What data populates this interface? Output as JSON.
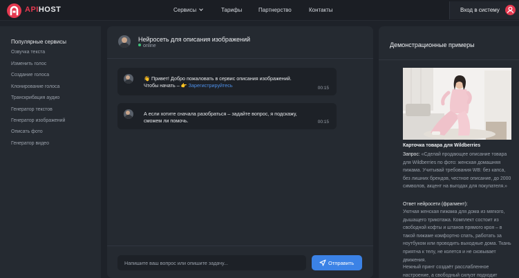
{
  "brand": {
    "part1": "API",
    "part2": "HOST"
  },
  "nav": {
    "services": "Сервисы",
    "tariffs": "Тарифы",
    "partnership": "Партнерство",
    "contacts": "Контакты"
  },
  "login_label": "Вход в систему",
  "sidebar": {
    "title": "Популярные сервисы",
    "items": [
      {
        "label": "Озвучка текста"
      },
      {
        "label": "Изменить голос"
      },
      {
        "label": "Создание голоса"
      },
      {
        "label": "Клонирование голоса"
      },
      {
        "label": "Транскрибация аудио"
      },
      {
        "label": "Генератор текстов"
      },
      {
        "label": "Генератор изображений"
      },
      {
        "label": "Описать фото"
      },
      {
        "label": "Генератор видео"
      }
    ]
  },
  "chat": {
    "title": "Нейросеть для описания изображений",
    "status": "online",
    "messages": [
      {
        "line1": "👋 Привет! Добро пожаловать в сервис описания изображений.",
        "line2": "Чтобы начать – 👉 ",
        "link": "Зарегистрируйтесь",
        "time": "00:15"
      },
      {
        "line1": "А если хотите сначала разобраться – задайте вопрос, я подскажу,",
        "line2": "сможем ли помочь.",
        "time": "00:15"
      }
    ],
    "input_placeholder": "Напишите ваш вопрос или опишите задачу...",
    "send_label": "Отправить"
  },
  "demo": {
    "title": "Демонстрационные примеры",
    "card_title": "Карточка товара для Wildberries",
    "request_label": "Запрос:",
    "request_text": " «Сделай продающее описание товара для Wildberries по фото: женская домашняя пижама. Учитывай требования WB: без капса, без лишних брендов, честное описание, до 2000 символов, акцент на выгодах для покупателя.»",
    "answer_label": "Ответ нейросети (фрагмент):",
    "answer_text": "Уютная женская пижама для дома из мягкого, дышащего трикотажа. Комплект состоит из свободной кофты и штанов прямого кроя – в такой пижаме комфортно спать, работать за ноутбуком или проводить выходные дома. Ткань приятна к телу, не колется и не сковывает движения.",
    "answer_text2": "Нежный принт создаёт расслабленное настроение, а свободный силуэт подходит"
  },
  "colors": {
    "accent": "#e53950",
    "primary_button": "#3b82e6",
    "link": "#4d8fe8",
    "online": "#3ec07a",
    "background": "#1e2229",
    "panel": "#252a31"
  },
  "icons": [
    "logo-icon",
    "chevron-down-icon",
    "user-icon",
    "avatar-icon",
    "send-icon"
  ]
}
